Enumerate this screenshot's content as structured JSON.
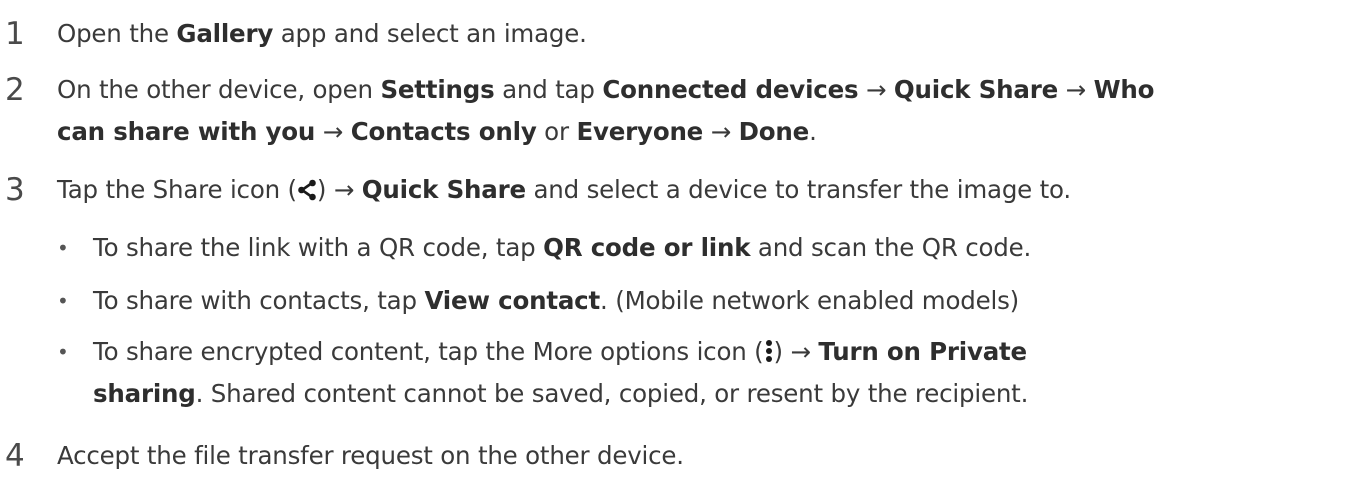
{
  "steps": [
    {
      "number": "1",
      "t1": "Open the ",
      "b1": "Gallery",
      "t2": " app and select an image."
    },
    {
      "number": "2",
      "line1": {
        "t1": "On the other device, open ",
        "b1": "Settings",
        "t2": " and tap ",
        "b2": "Connected devices",
        "t3": " → ",
        "b3": "Quick Share",
        "t4": " → ",
        "b4": "Who"
      },
      "line2": {
        "b1": "can share with you",
        "t1": " → ",
        "b2": "Contacts only",
        "t2": " or ",
        "b3": "Everyone",
        "t3": " → ",
        "b4": "Done",
        "t4": "."
      }
    },
    {
      "number": "3",
      "t1": "Tap the Share icon (",
      "share_icon": "share-icon",
      "t2": ") → ",
      "b1": "Quick Share",
      "t3": " and select a device to transfer the image to.",
      "bullets": [
        {
          "t1": "To share the link with a QR code, tap ",
          "b1": "QR code or link",
          "t2": " and scan the QR code."
        },
        {
          "t1": "To share with contacts, tap ",
          "b1": "View contact",
          "t2": ". (Mobile network enabled models)"
        },
        {
          "line1": {
            "t1": "To share encrypted content, tap the More options icon (",
            "more_icon": "more-options-icon",
            "t2": ") → ",
            "b1": "Turn on Private"
          },
          "line2": {
            "b1": "sharing",
            "t1": ". Shared content cannot be saved, copied, or resent by the recipient."
          }
        }
      ]
    },
    {
      "number": "4",
      "t1": "Accept the file transfer request on the other device."
    }
  ],
  "bullet_char": "•"
}
